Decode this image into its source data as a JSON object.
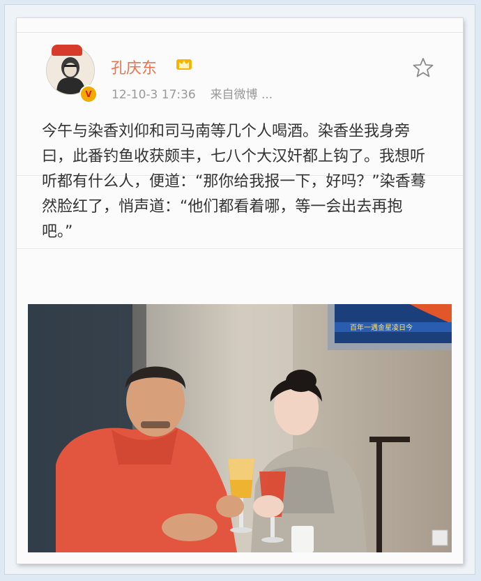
{
  "post": {
    "username": "孔庆东",
    "time": "12-10-3 17:36",
    "source": "来自微博 ...",
    "text": "今午与染香刘仰和司马南等几个人喝酒。染香坐我身旁曰，此番钓鱼收获颇丰，七八个大汉奸都上钩了。我想听听都有什么人，便道：“那你给我报一下，好吗？”染香蓦然脸红了，悄声道：“他们都看着哪，等一会出去再抱吧。”"
  },
  "photo": {
    "tv_caption": "百年一遇金星凌日今"
  },
  "icons": {
    "verified": "verified-v-icon",
    "crown": "crown-icon",
    "favorite": "star-icon"
  },
  "colors": {
    "username": "#eb7350",
    "meta": "#999999",
    "text": "#333333",
    "badge": "#f2a900"
  }
}
